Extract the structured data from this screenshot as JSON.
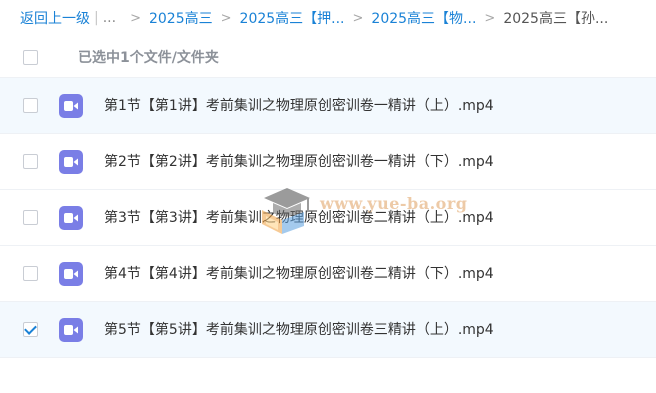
{
  "breadcrumb": {
    "back_label": "返回上一级",
    "pipe": "|",
    "ellipsis": "...",
    "sep": ">",
    "items": [
      "2025高三",
      "2025高三【押...",
      "2025高三【物..."
    ],
    "current": "2025高三【孙..."
  },
  "selection": {
    "summary": "已选中1个文件/文件夹"
  },
  "files": [
    {
      "name": "第1节【第1讲】考前集训之物理原创密训卷一精讲（上）.mp4",
      "checked": false,
      "highlighted": true
    },
    {
      "name": "第2节【第2讲】考前集训之物理原创密训卷一精讲（下）.mp4",
      "checked": false,
      "highlighted": false
    },
    {
      "name": "第3节【第3讲】考前集训之物理原创密训卷二精讲（上）.mp4",
      "checked": false,
      "highlighted": false
    },
    {
      "name": "第4节【第4讲】考前集训之物理原创密训卷二精讲（下）.mp4",
      "checked": false,
      "highlighted": false
    },
    {
      "name": "第5节【第5讲】考前集训之物理原创密训卷三精讲（上）.mp4",
      "checked": true,
      "highlighted": true
    }
  ],
  "watermark": {
    "text": "www.yue-ba.org",
    "icon": "graduation-cap-logo"
  },
  "colors": {
    "link": "#1a82d6",
    "video_icon": "#7a7ee6",
    "row_highlight": "#f3f9fe",
    "check": "#1a82d6"
  }
}
